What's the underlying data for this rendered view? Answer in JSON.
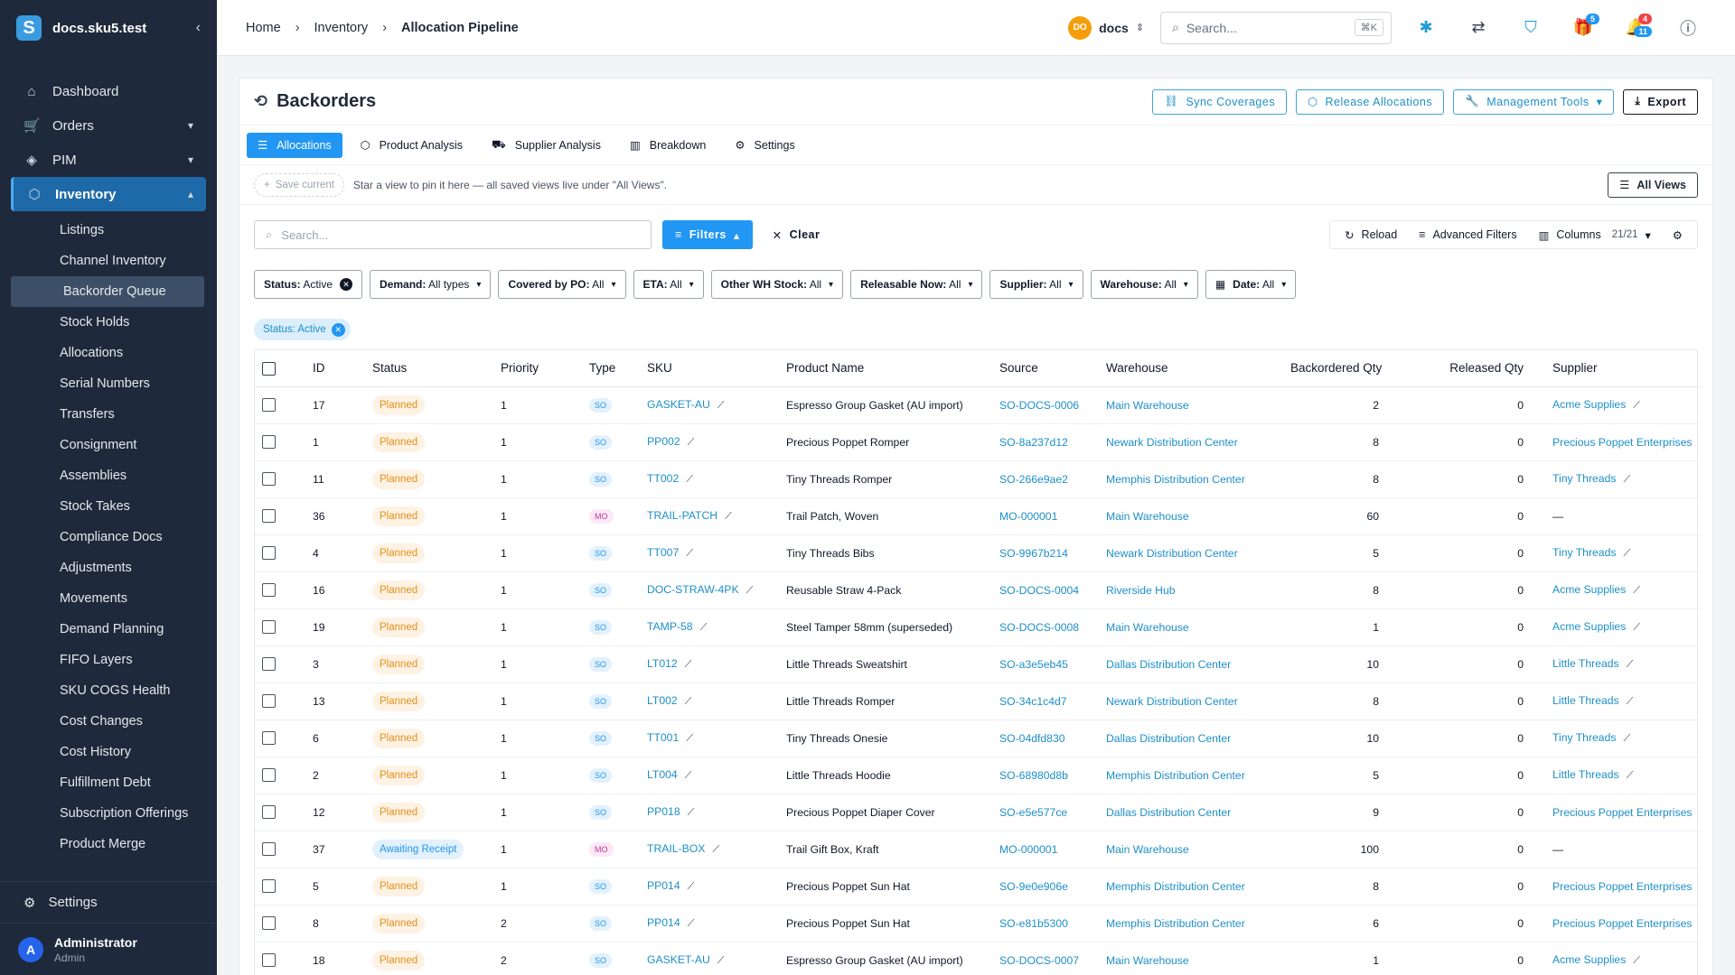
{
  "brand": {
    "name": "docs.sku5.test",
    "logo": "S"
  },
  "sidebar": {
    "items": [
      {
        "label": "Dashboard",
        "icon": "home-icon"
      },
      {
        "label": "Orders",
        "icon": "cart-icon"
      },
      {
        "label": "PIM",
        "icon": "tag-icon"
      },
      {
        "label": "Inventory",
        "icon": "box-icon"
      }
    ],
    "sub_items": [
      "Listings",
      "Channel Inventory",
      "Backorder Queue",
      "Stock Holds",
      "Allocations",
      "Serial Numbers",
      "Transfers",
      "Consignment",
      "Assemblies",
      "Stock Takes",
      "Compliance Docs",
      "Adjustments",
      "Movements",
      "Demand Planning",
      "FIFO Layers",
      "SKU COGS Health",
      "Cost Changes",
      "Cost History",
      "Fulfillment Debt",
      "Subscription Offerings",
      "Product Merge"
    ],
    "settings_label": "Settings",
    "user": {
      "initial": "A",
      "name": "Administrator",
      "role": "Admin"
    }
  },
  "breadcrumb": {
    "home": "Home",
    "section": "Inventory",
    "current": "Allocation Pipeline"
  },
  "topbar": {
    "org_initials": "DO",
    "org_name": "docs",
    "search_placeholder": "Search...",
    "search_shortcut": "⌘K",
    "gift_count": "5",
    "notif_count": "4",
    "notif_count2": "11"
  },
  "page": {
    "title": "Backorders",
    "buttons": {
      "sync": "Sync Coverages",
      "release": "Release Allocations",
      "management": "Management Tools",
      "export": "Export"
    },
    "tabs": [
      "Allocations",
      "Product Analysis",
      "Supplier Analysis",
      "Breakdown",
      "Settings"
    ],
    "views": {
      "save_current": "Save current",
      "hint": "Star a view to pin it here — all saved views live under \"All Views\".",
      "all_views": "All Views"
    },
    "toolbar": {
      "search_placeholder": "Search...",
      "filters": "Filters",
      "clear": "Clear",
      "reload": "Reload",
      "advanced": "Advanced Filters",
      "columns": "Columns",
      "columns_count": "21/21"
    },
    "filter_chips": [
      {
        "label": "Status:",
        "value": "Active"
      },
      {
        "label": "Demand:",
        "value": "All types"
      },
      {
        "label": "Covered by PO:",
        "value": "All"
      },
      {
        "label": "ETA:",
        "value": "All"
      },
      {
        "label": "Other WH Stock:",
        "value": "All"
      },
      {
        "label": "Releasable Now:",
        "value": "All"
      },
      {
        "label": "Supplier:",
        "value": "All"
      },
      {
        "label": "Warehouse:",
        "value": "All"
      },
      {
        "label": "Date:",
        "value": "All"
      }
    ],
    "active_tag": "Status: Active"
  },
  "table": {
    "headers": [
      "ID",
      "Status",
      "Priority",
      "Type",
      "SKU",
      "Product Name",
      "Source",
      "Warehouse",
      "Backordered Qty",
      "Released Qty",
      "Supplier"
    ],
    "rows": [
      [
        "17",
        "Planned",
        "1",
        "SO",
        "GASKET-AU",
        "Espresso Group Gasket (AU import)",
        "SO-DOCS-0006",
        "Main Warehouse",
        "2",
        "0",
        "Acme Supplies"
      ],
      [
        "1",
        "Planned",
        "1",
        "SO",
        "PP002",
        "Precious Poppet Romper",
        "SO-8a237d12",
        "Newark Distribution Center",
        "8",
        "0",
        "Precious Poppet Enterprises"
      ],
      [
        "11",
        "Planned",
        "1",
        "SO",
        "TT002",
        "Tiny Threads Romper",
        "SO-266e9ae2",
        "Memphis Distribution Center",
        "8",
        "0",
        "Tiny Threads"
      ],
      [
        "36",
        "Planned",
        "1",
        "MO",
        "TRAIL-PATCH",
        "Trail Patch, Woven",
        "MO-000001",
        "Main Warehouse",
        "60",
        "0",
        "—"
      ],
      [
        "4",
        "Planned",
        "1",
        "SO",
        "TT007",
        "Tiny Threads Bibs",
        "SO-9967b214",
        "Newark Distribution Center",
        "5",
        "0",
        "Tiny Threads"
      ],
      [
        "16",
        "Planned",
        "1",
        "SO",
        "DOC-STRAW-4PK",
        "Reusable Straw 4-Pack",
        "SO-DOCS-0004",
        "Riverside Hub",
        "8",
        "0",
        "Acme Supplies"
      ],
      [
        "19",
        "Planned",
        "1",
        "SO",
        "TAMP-58",
        "Steel Tamper 58mm (superseded)",
        "SO-DOCS-0008",
        "Main Warehouse",
        "1",
        "0",
        "Acme Supplies"
      ],
      [
        "3",
        "Planned",
        "1",
        "SO",
        "LT012",
        "Little Threads Sweatshirt",
        "SO-a3e5eb45",
        "Dallas Distribution Center",
        "10",
        "0",
        "Little Threads"
      ],
      [
        "13",
        "Planned",
        "1",
        "SO",
        "LT002",
        "Little Threads Romper",
        "SO-34c1c4d7",
        "Newark Distribution Center",
        "8",
        "0",
        "Little Threads"
      ],
      [
        "6",
        "Planned",
        "1",
        "SO",
        "TT001",
        "Tiny Threads Onesie",
        "SO-04dfd830",
        "Dallas Distribution Center",
        "10",
        "0",
        "Tiny Threads"
      ],
      [
        "2",
        "Planned",
        "1",
        "SO",
        "LT004",
        "Little Threads Hoodie",
        "SO-68980d8b",
        "Memphis Distribution Center",
        "5",
        "0",
        "Little Threads"
      ],
      [
        "12",
        "Planned",
        "1",
        "SO",
        "PP018",
        "Precious Poppet Diaper Cover",
        "SO-e5e577ce",
        "Dallas Distribution Center",
        "9",
        "0",
        "Precious Poppet Enterprises"
      ],
      [
        "37",
        "Awaiting Receipt",
        "1",
        "MO",
        "TRAIL-BOX",
        "Trail Gift Box, Kraft",
        "MO-000001",
        "Main Warehouse",
        "100",
        "0",
        "—"
      ],
      [
        "5",
        "Planned",
        "1",
        "SO",
        "PP014",
        "Precious Poppet Sun Hat",
        "SO-9e0e906e",
        "Memphis Distribution Center",
        "8",
        "0",
        "Precious Poppet Enterprises"
      ],
      [
        "8",
        "Planned",
        "2",
        "SO",
        "PP014",
        "Precious Poppet Sun Hat",
        "SO-e81b5300",
        "Memphis Distribution Center",
        "6",
        "0",
        "Precious Poppet Enterprises"
      ],
      [
        "18",
        "Planned",
        "2",
        "SO",
        "GASKET-AU",
        "Espresso Group Gasket (AU import)",
        "SO-DOCS-0007",
        "Main Warehouse",
        "1",
        "0",
        "Acme Supplies"
      ]
    ]
  }
}
